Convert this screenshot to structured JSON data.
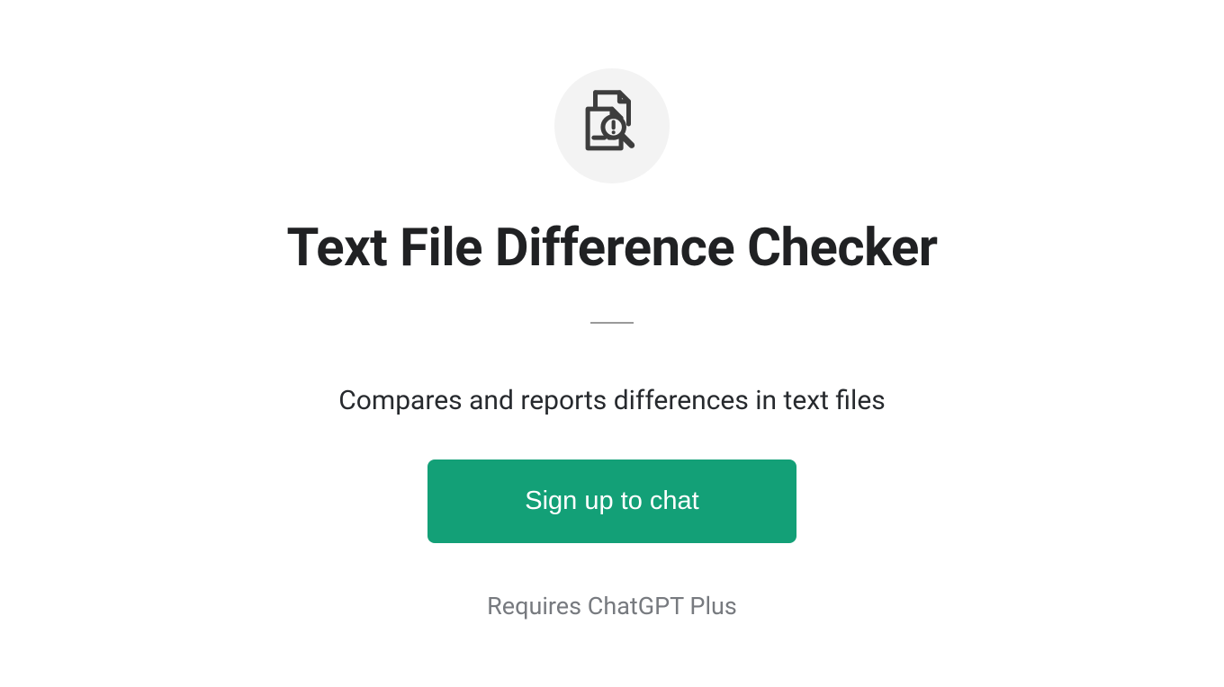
{
  "app": {
    "icon_name": "document-diff-icon",
    "title": "Text File Difference Checker",
    "description": "Compares and reports differences in text files",
    "signup_button_label": "Sign up to chat",
    "requirement_text": "Requires ChatGPT Plus"
  },
  "colors": {
    "accent": "#13a077",
    "text_primary": "#202123",
    "text_secondary": "#777a7f",
    "icon_bg": "#f3f3f3"
  }
}
